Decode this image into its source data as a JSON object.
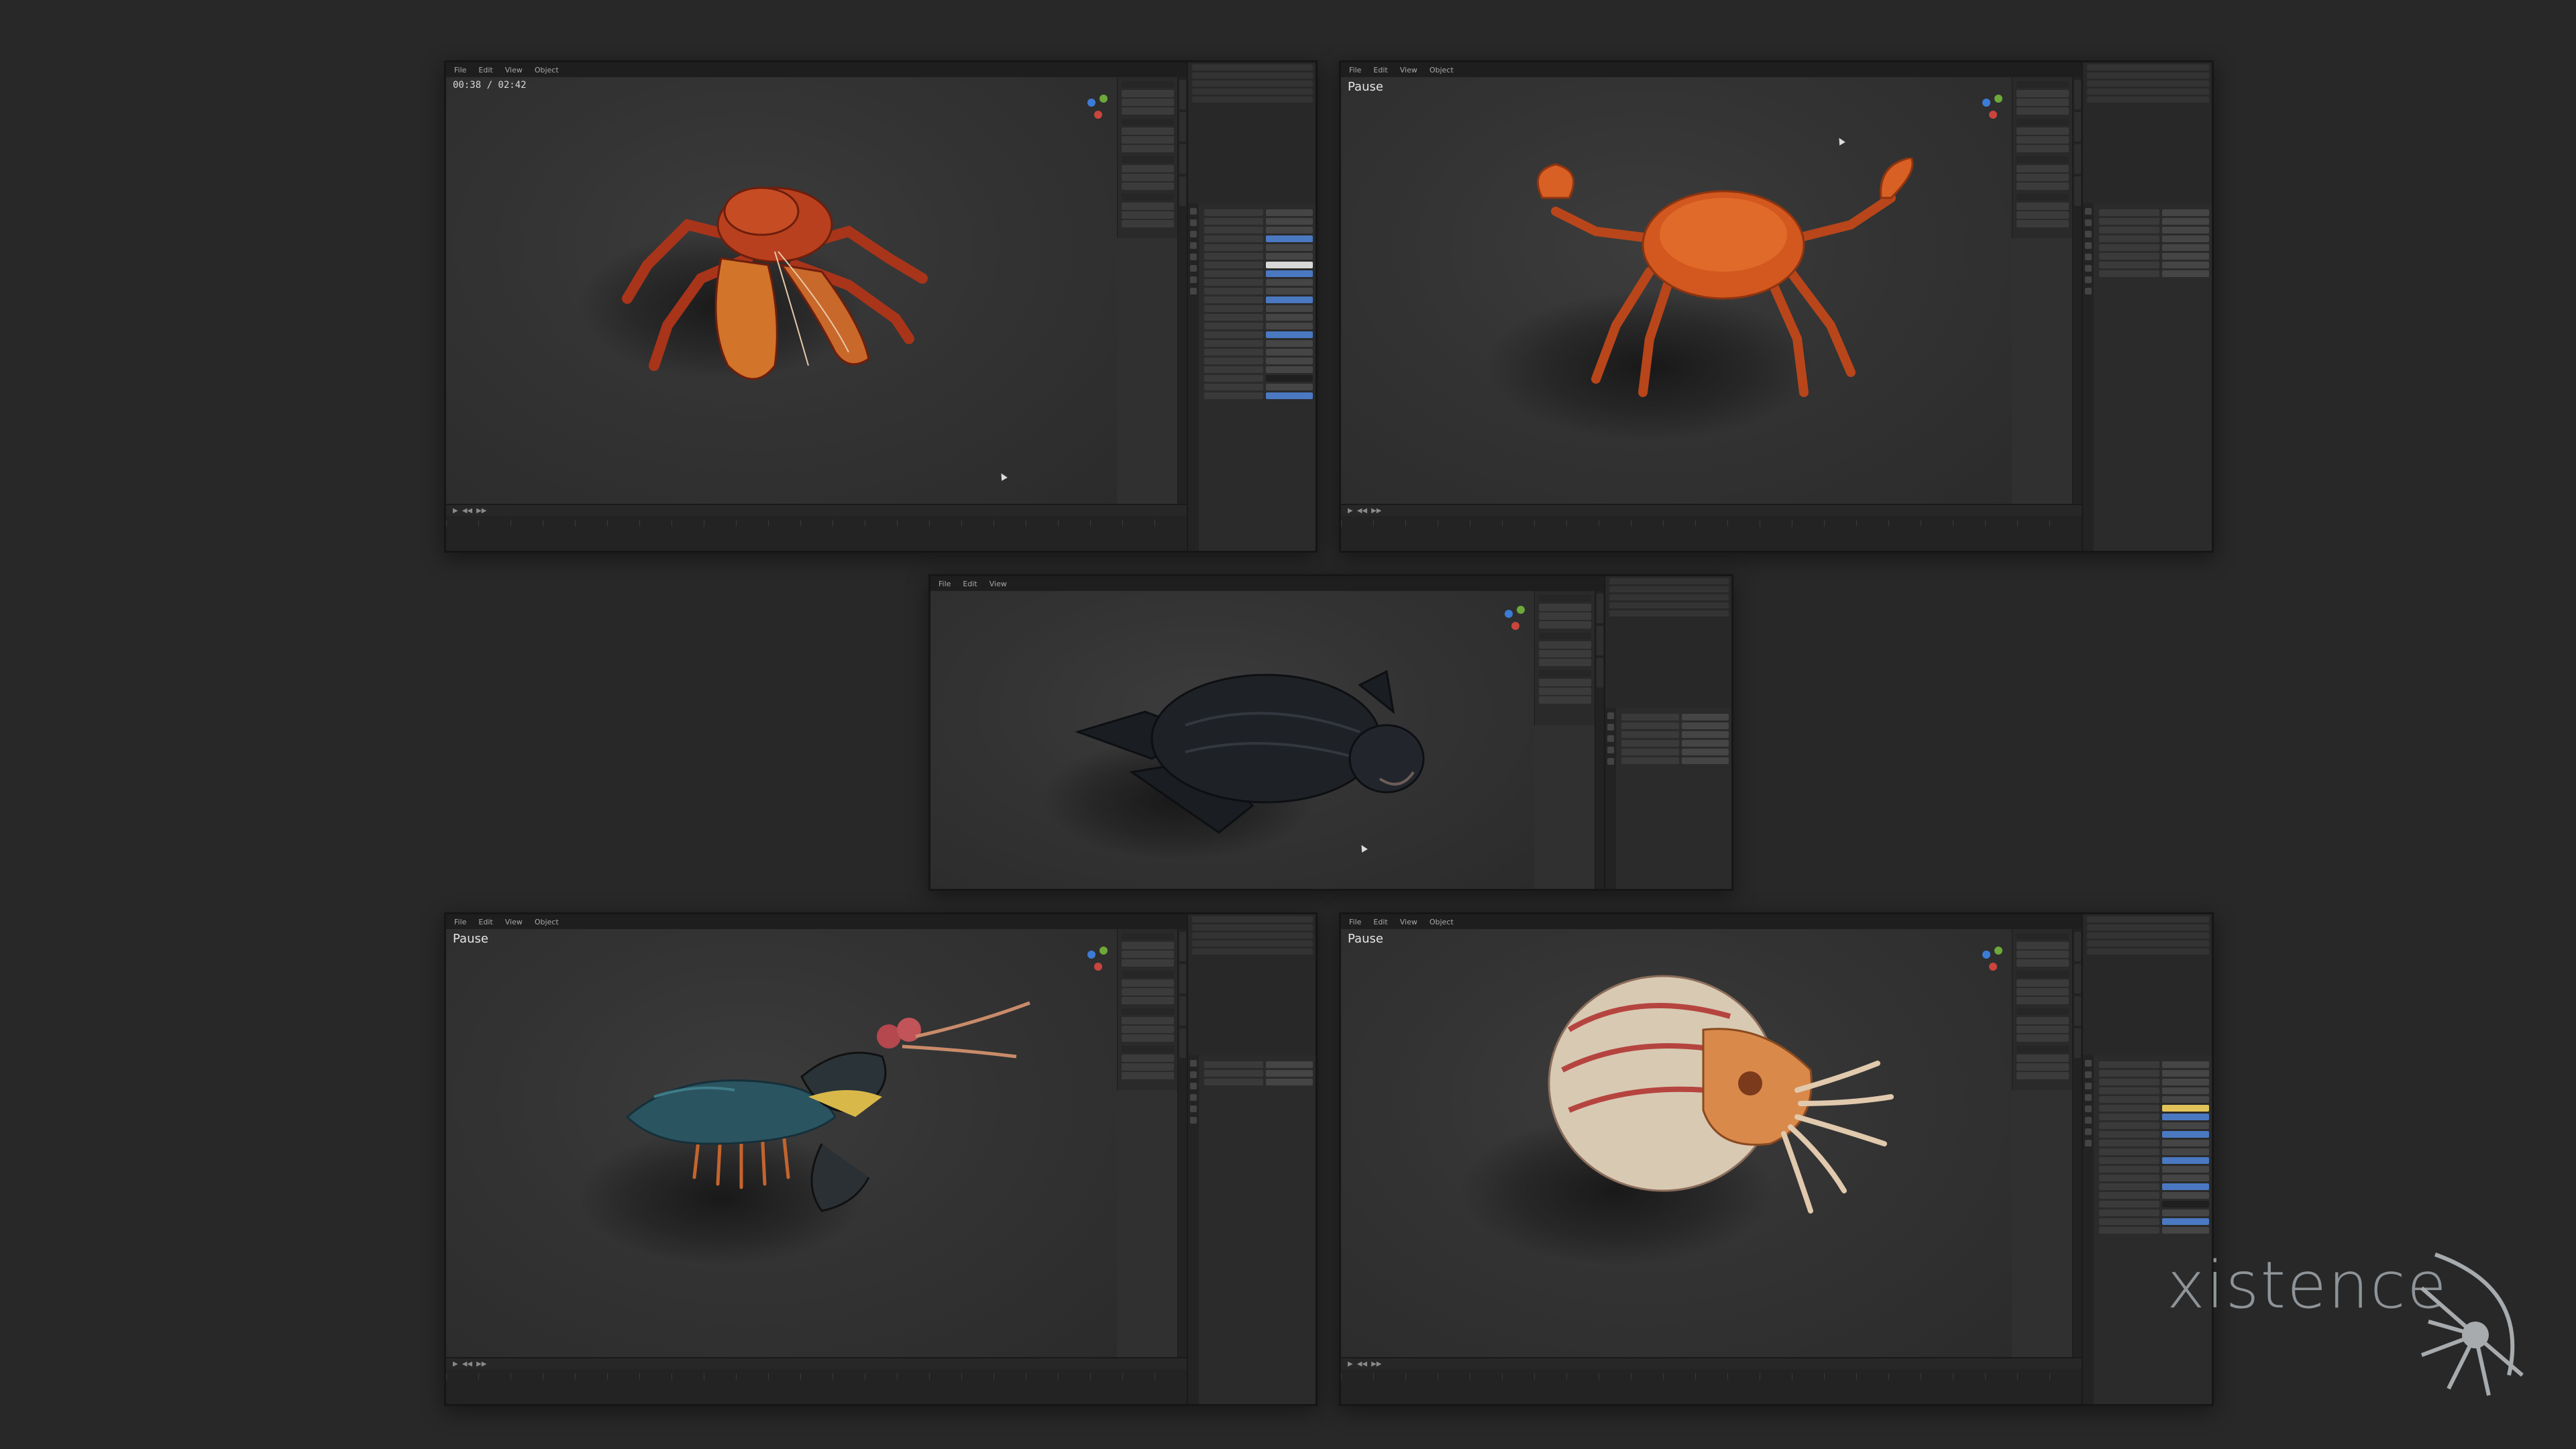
{
  "panels": [
    {
      "id": "hermit-crab",
      "header_label": "00:38 / 02:42",
      "subject": "Hermit crab model"
    },
    {
      "id": "red-crab",
      "header_label": "Pause",
      "subject": "Red crab model"
    },
    {
      "id": "leatherback-turtle",
      "header_label": "",
      "subject": "Leatherback turtle model"
    },
    {
      "id": "mantis-shrimp",
      "header_label": "Pause",
      "subject": "Mantis shrimp model"
    },
    {
      "id": "nautilus",
      "header_label": "Pause",
      "subject": "Nautilus model"
    }
  ],
  "menu": [
    "File",
    "Edit",
    "View",
    "Object"
  ],
  "brand": {
    "text": "xistence"
  },
  "colors": {
    "background": "#282828",
    "viewport": "#333333",
    "accent_blue": "#4a79c2",
    "crab_orange": "#d2581f",
    "hermit_red": "#b83a1c",
    "turtle_black": "#1e2126",
    "mantis_teal": "#2a5460",
    "nautilus_cream": "#d8c9b3"
  }
}
